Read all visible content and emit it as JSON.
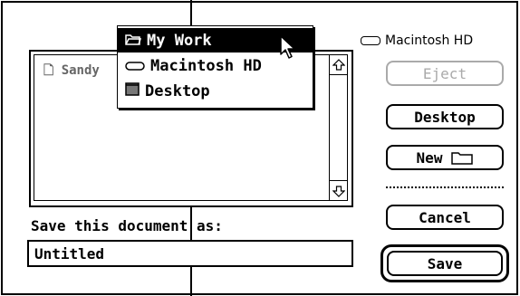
{
  "file_list": {
    "item": "Sandy"
  },
  "popup_menu": {
    "items": [
      {
        "label": "My Work",
        "icon": "folder-open-icon",
        "selected": true
      },
      {
        "label": "Macintosh HD",
        "icon": "hard-disk-icon",
        "selected": false
      },
      {
        "label": "Desktop",
        "icon": "desktop-icon",
        "selected": false
      }
    ]
  },
  "volume_name": "Macintosh HD",
  "buttons": {
    "eject": "Eject",
    "desktop": "Desktop",
    "new": "New",
    "cancel": "Cancel",
    "save": "Save"
  },
  "save_prompt": "Save this document as:",
  "filename_value": "Untitled"
}
